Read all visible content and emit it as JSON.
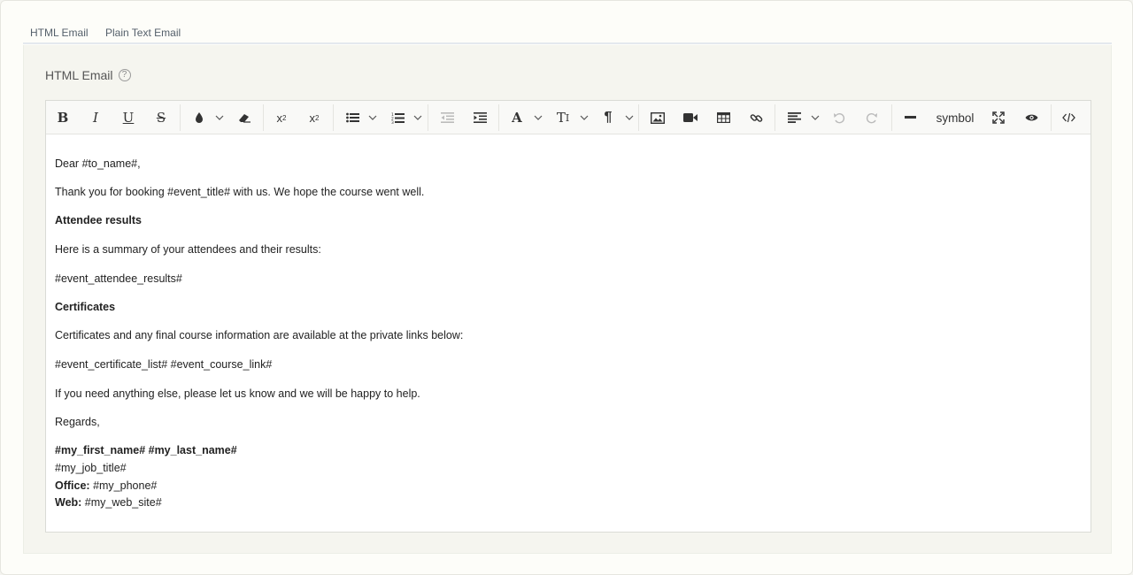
{
  "tabs": [
    {
      "label": "HTML Email"
    },
    {
      "label": "Plain Text Email"
    }
  ],
  "field": {
    "label": "HTML Email",
    "help": "?"
  },
  "toolbar": {
    "symbol_label": "symbol"
  },
  "body": {
    "greeting": "Dear #to_name#,",
    "thanks": "Thank you for booking #event_title# with us. We hope the course went well.",
    "attendee_heading": "Attendee results",
    "summary": "Here is a summary of your attendees and their results:",
    "results_tag": "#event_attendee_results#",
    "cert_heading": "Certificates",
    "cert_text": "Certificates and any final course information are available at the private links below:",
    "links": "#event_certificate_list# #event_course_link#",
    "help": "If you need anything else, please let us know and we will be happy to help.",
    "regards": "Regards,",
    "signature_name": "#my_first_name# #my_last_name#",
    "job_title": "#my_job_title#",
    "office_label": "Office:",
    "office_value": " #my_phone#",
    "web_label": "Web:",
    "web_value": " #my_web_site#"
  },
  "colors": {
    "background": "#fdfdf9",
    "panel": "#f5f5ef",
    "toolbar": "#f9f9f7"
  }
}
